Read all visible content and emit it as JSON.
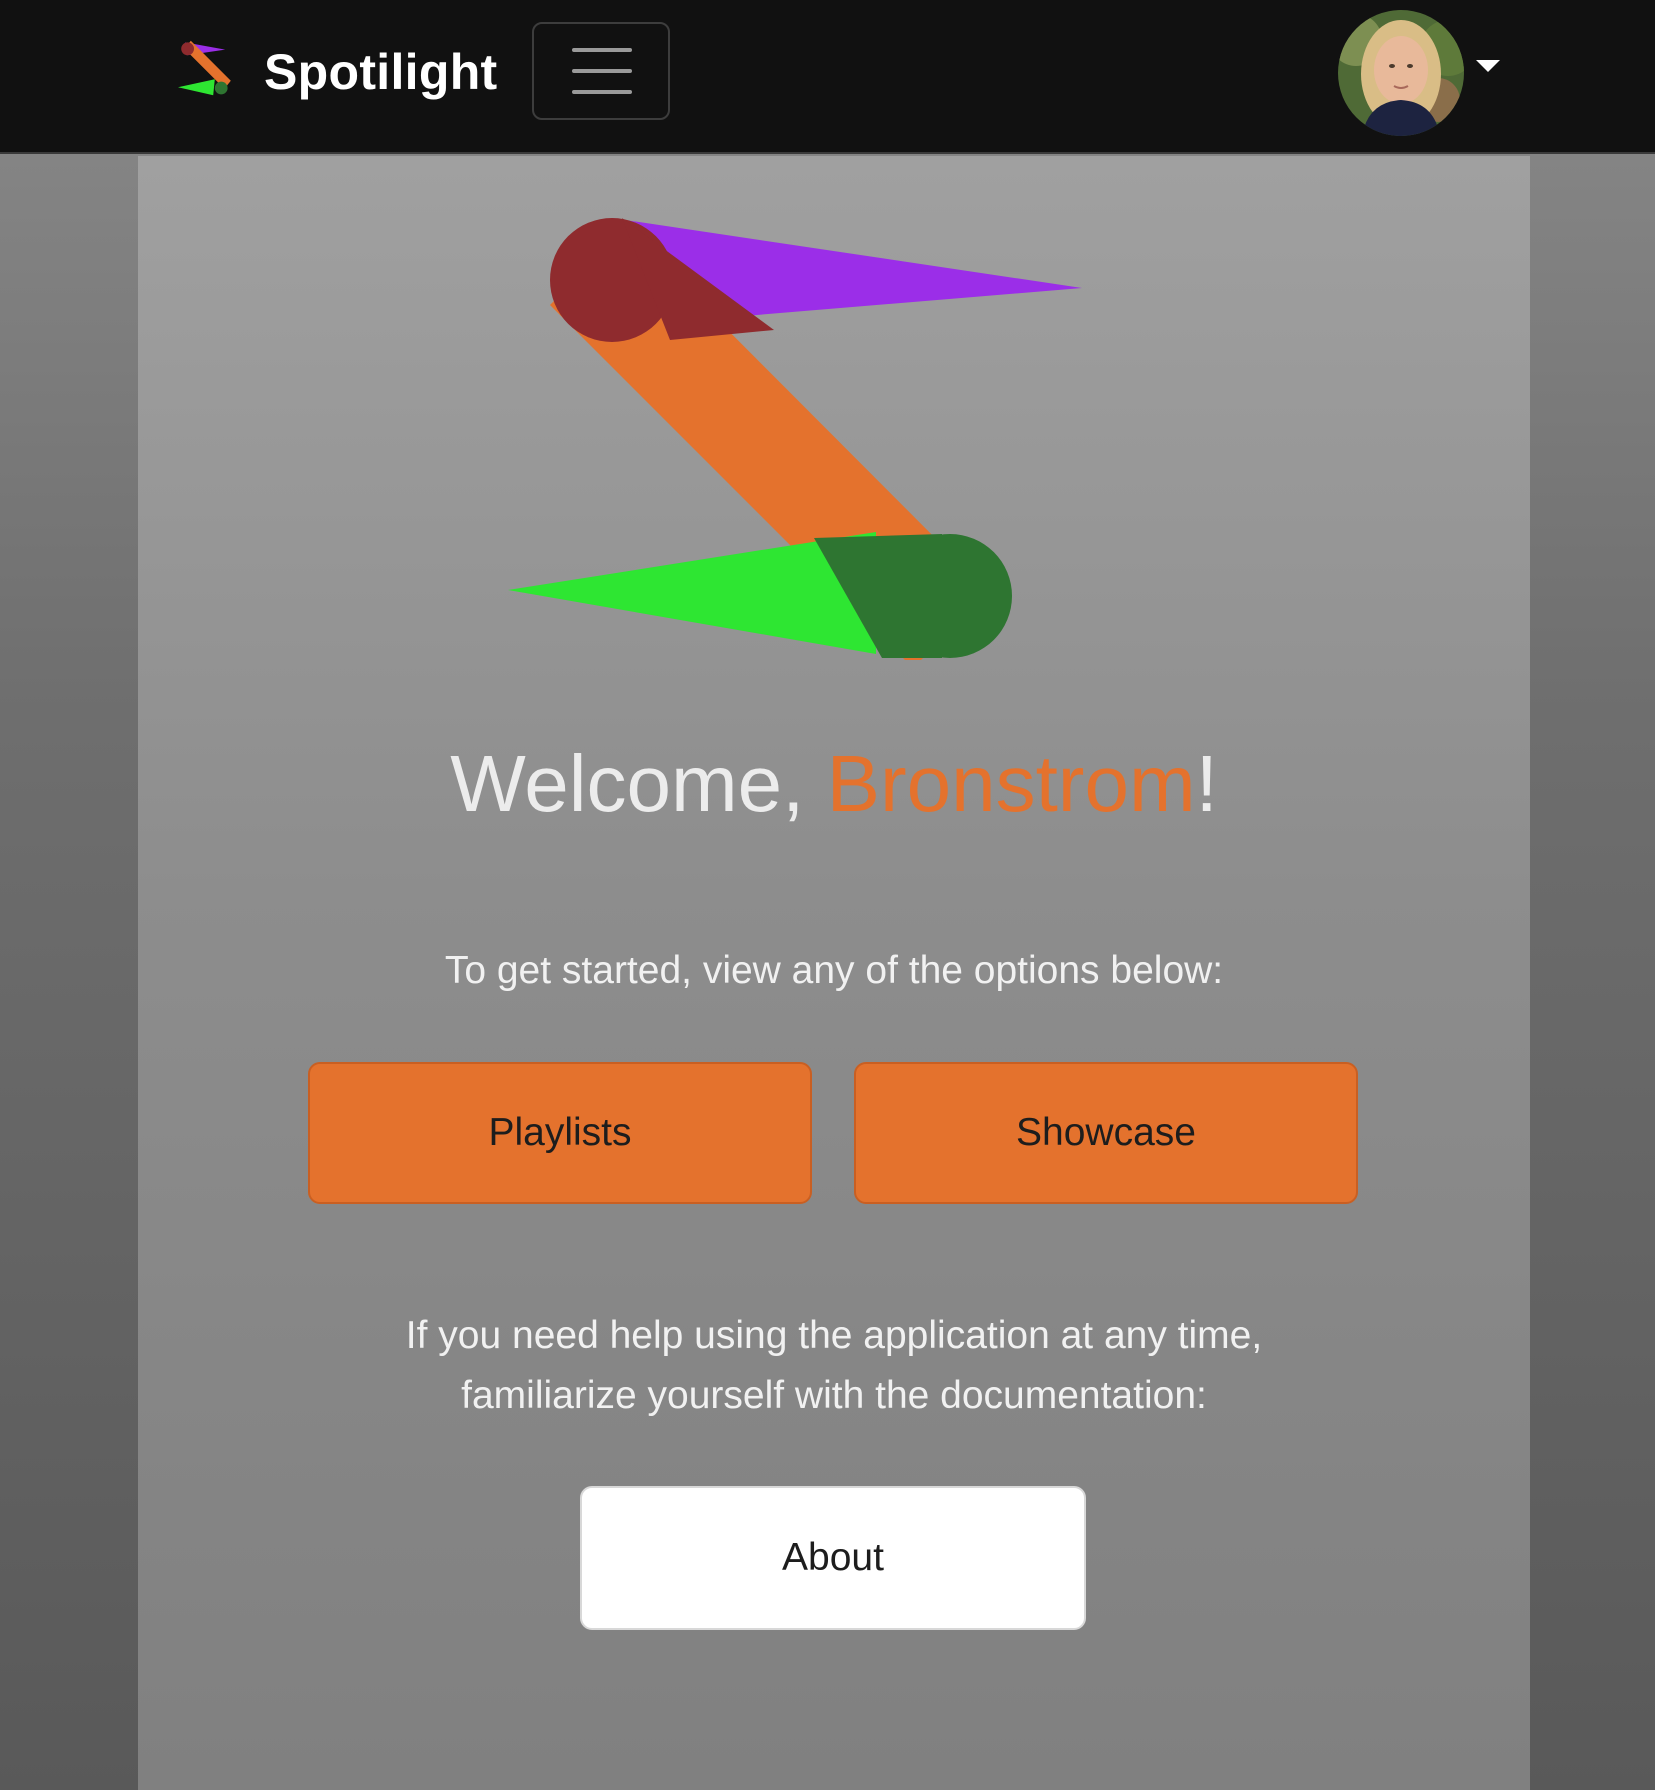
{
  "colors": {
    "accent": "#e4722d",
    "navbar": "#111111",
    "logo_purple": "#9b2ee8",
    "logo_orange": "#e4722d",
    "logo_green": "#2ee632",
    "logo_dark_red": "#8f2b2e",
    "logo_dark_green": "#2e7531"
  },
  "navbar": {
    "brand_name": "Spotilight",
    "brand_icon": "spotilight-logo-icon",
    "menu_icon": "hamburger-menu-icon",
    "profile_icon": "user-avatar",
    "dropdown_icon": "caret-down-icon"
  },
  "welcome": {
    "greeting": "Welcome, ",
    "username": "Bronstrom",
    "exclamation": "!"
  },
  "intro_text": "To get started, view any of the options below:",
  "buttons": {
    "playlists": "Playlists",
    "showcase": "Showcase",
    "about": "About"
  },
  "help": {
    "line1": "If you need help using the application at any time,",
    "line2": "familiarize yourself with the documentation:"
  }
}
